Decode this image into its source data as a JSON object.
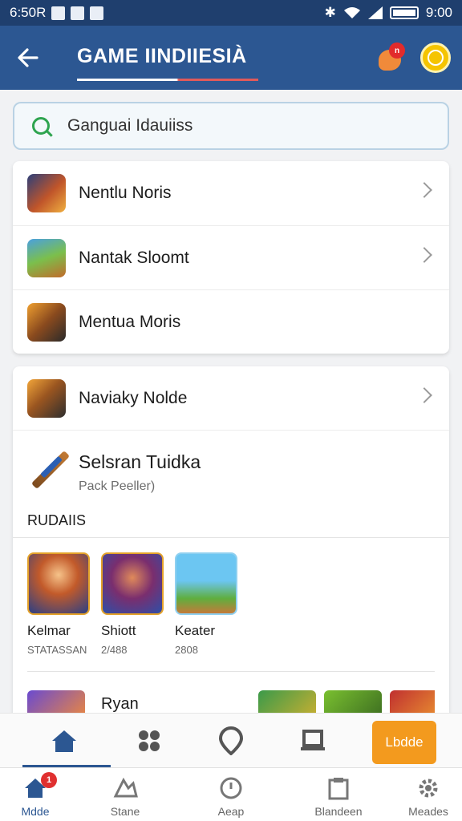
{
  "status_bar": {
    "time": "6:50R",
    "clock_right": "9:00"
  },
  "app_bar": {
    "title": "GAME IINDIIESIÀ",
    "notification_badge": "n"
  },
  "search": {
    "placeholder": "Ganguai Idauiiss"
  },
  "menu_list": [
    {
      "label": "Nentlu Noris",
      "icon": "warrior-portrait"
    },
    {
      "label": "Nantak Sloomt",
      "icon": "soldier-scene"
    },
    {
      "label": "Mentua Moris",
      "icon": "rifle-weapon"
    }
  ],
  "section": {
    "row_label": "Naviaky Nolde",
    "featured_title": "Selsran Tuidka",
    "featured_subtitle": "Pack Peeller)",
    "header": "RUDAIIS",
    "games": [
      {
        "name": "Kelmar",
        "meta": "STATASSAN"
      },
      {
        "name": "Shiott",
        "meta": "2/488"
      },
      {
        "name": "Keater",
        "meta": "2808"
      }
    ],
    "peek_label": "Ryan"
  },
  "action_bar": {
    "primary_label": "Lbdde"
  },
  "bottom_nav": [
    {
      "label": "Mdde",
      "icon": "home-icon",
      "badge": "1"
    },
    {
      "label": "Stane",
      "icon": "store-icon"
    },
    {
      "label": "Aeap",
      "icon": "clock-icon"
    },
    {
      "label": "Blandeen",
      "icon": "clipboard-icon"
    },
    {
      "label": "Meades",
      "icon": "gear-icon"
    }
  ],
  "colors": {
    "app_bar": "#2c5792",
    "status_bar": "#1f3f6e",
    "accent_orange": "#f39a1e",
    "badge_red": "#e22b2b",
    "search_green": "#2ea44f"
  }
}
